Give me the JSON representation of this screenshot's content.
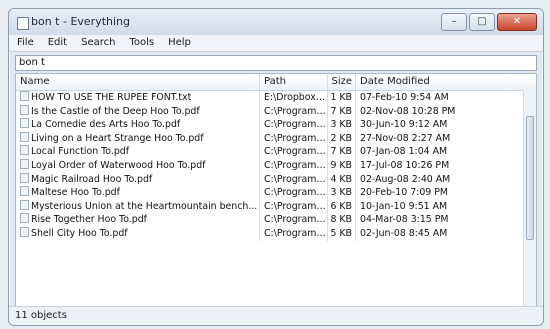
{
  "window": {
    "title": "bon t - Everything"
  },
  "menu": [
    "File",
    "Edit",
    "Search",
    "Tools",
    "Help"
  ],
  "search": {
    "value": "bon t"
  },
  "columns": {
    "name": "Name",
    "path": "Path",
    "size": "Size",
    "date": "Date Modified"
  },
  "rows": [
    {
      "name": "HOW TO USE THE RUPEE FONT.txt",
      "path": "E:\\Dropbox\\A...",
      "size": "1 KB",
      "date": "07-Feb-10 9:54 AM"
    },
    {
      "name": "Is the Castle of the Deep Hoo To.pdf",
      "path": "C:\\Program Fil...",
      "size": "7 KB",
      "date": "02-Nov-08 10:28 PM"
    },
    {
      "name": "La Comedie des Arts Hoo To.pdf",
      "path": "C:\\Program Fil...",
      "size": "3 KB",
      "date": "30-Jun-10 9:12 AM"
    },
    {
      "name": "Living on a Heart Strange Hoo To.pdf",
      "path": "C:\\Program Fil...",
      "size": "2 KB",
      "date": "27-Nov-08 2:27 AM"
    },
    {
      "name": "Local Function To.pdf",
      "path": "C:\\Program Fil...",
      "size": "7 KB",
      "date": "07-Jan-08 1:04 AM"
    },
    {
      "name": "Loyal Order of Waterwood Hoo To.pdf",
      "path": "C:\\Program Fil...",
      "size": "9 KB",
      "date": "17-Jul-08 10:26 PM"
    },
    {
      "name": "Magic Railroad Hoo To.pdf",
      "path": "C:\\Program Fil...",
      "size": "4 KB",
      "date": "02-Aug-08 2:40 AM"
    },
    {
      "name": "Maltese Hoo To.pdf",
      "path": "C:\\Program Fil...",
      "size": "3 KB",
      "date": "20-Feb-10 7:09 PM"
    },
    {
      "name": "Mysterious Union at the Heartmountain bench...",
      "path": "C:\\Program Fil...",
      "size": "6 KB",
      "date": "10-Jan-10 9:51 AM"
    },
    {
      "name": "Rise Together Hoo To.pdf",
      "path": "C:\\Program Fil...",
      "size": "8 KB",
      "date": "04-Mar-08 3:15 PM"
    },
    {
      "name": "Shell City Hoo To.pdf",
      "path": "C:\\Program Fil...",
      "size": "5 KB",
      "date": "02-Jun-08 8:45 AM"
    }
  ],
  "status": {
    "text": "11 objects"
  }
}
